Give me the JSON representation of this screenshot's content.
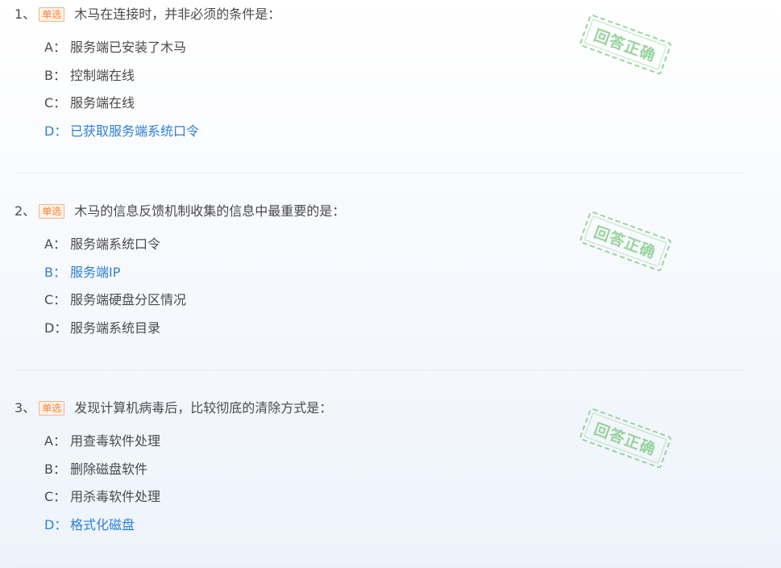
{
  "questions": [
    {
      "number": "1、",
      "type_badge": "单选",
      "text": "木马在连接时，并非必须的条件是：",
      "options": [
        {
          "key": "A：",
          "text": "服务端已安装了木马",
          "correct": false
        },
        {
          "key": "B：",
          "text": "控制端在线",
          "correct": false
        },
        {
          "key": "C：",
          "text": "服务端在线",
          "correct": false
        },
        {
          "key": "D：",
          "text": "已获取服务端系统口令",
          "correct": true
        }
      ],
      "stamp": "回答正确"
    },
    {
      "number": "2、",
      "type_badge": "单选",
      "text": "木马的信息反馈机制收集的信息中最重要的是：",
      "options": [
        {
          "key": "A：",
          "text": "服务端系统口令",
          "correct": false
        },
        {
          "key": "B：",
          "text": "服务端IP",
          "correct": true
        },
        {
          "key": "C：",
          "text": "服务端硬盘分区情况",
          "correct": false
        },
        {
          "key": "D：",
          "text": "服务端系统目录",
          "correct": false
        }
      ],
      "stamp": "回答正确"
    },
    {
      "number": "3、",
      "type_badge": "单选",
      "text": "发现计算机病毒后，比较彻底的清除方式是：",
      "options": [
        {
          "key": "A：",
          "text": "用查毒软件处理",
          "correct": false
        },
        {
          "key": "B：",
          "text": "删除磁盘软件",
          "correct": false
        },
        {
          "key": "C：",
          "text": "用杀毒软件处理",
          "correct": false
        },
        {
          "key": "D：",
          "text": "格式化磁盘",
          "correct": true
        }
      ],
      "stamp": "回答正确"
    }
  ],
  "colors": {
    "correct_option": "#2e7fd6",
    "badge_text": "#f0833a",
    "badge_bg": "#fff1e6",
    "stamp": "#8fcf93"
  }
}
